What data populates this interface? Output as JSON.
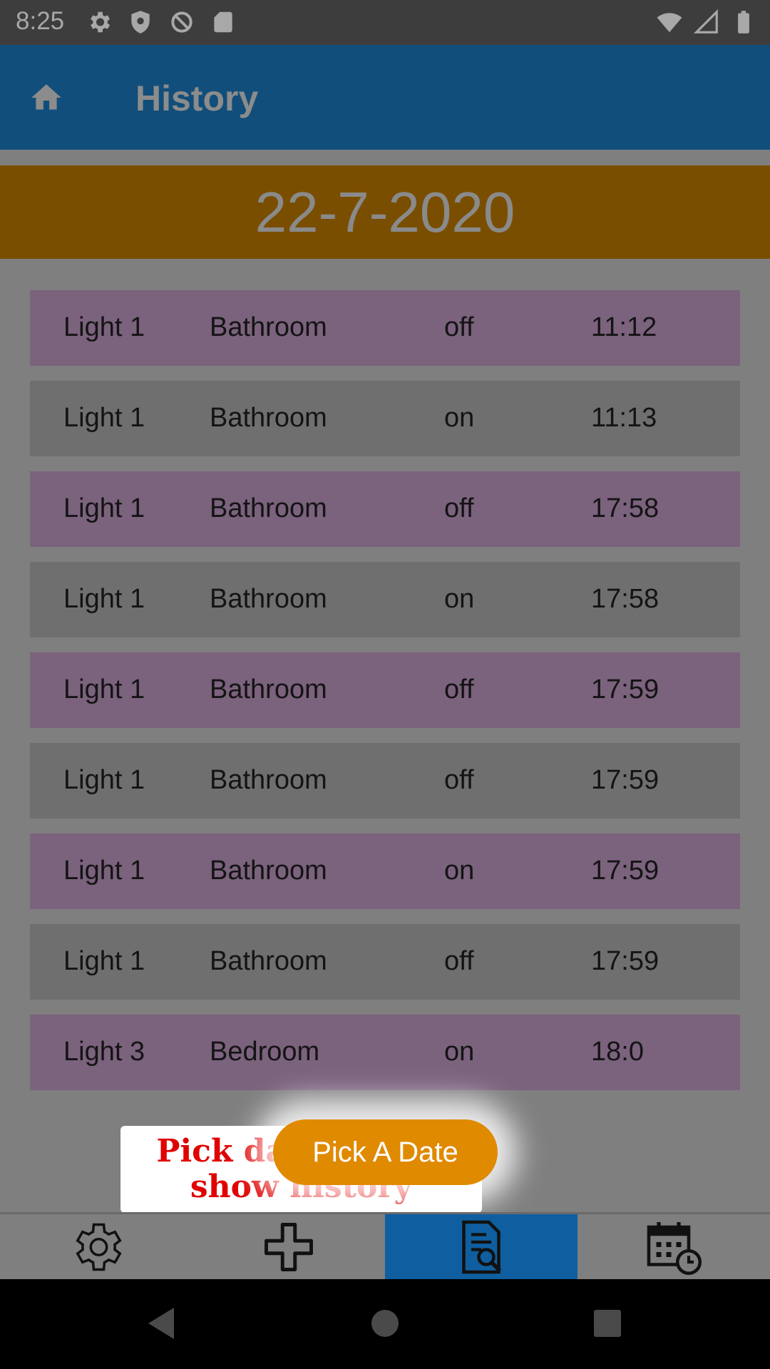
{
  "status_bar": {
    "time": "8:25",
    "left_icons": [
      "settings-gear-icon",
      "shield-icon",
      "no-sync-icon",
      "sd-card-icon"
    ],
    "right_icons": [
      "wifi-icon",
      "cell-signal-icon",
      "battery-icon"
    ]
  },
  "app_bar": {
    "title": "History",
    "home_icon": "home-icon",
    "background": "#114e7b"
  },
  "date_banner": {
    "date": "22-7-2020",
    "background": "#7a4e00"
  },
  "history": {
    "rows": [
      {
        "device": "Light 1",
        "room": "Bathroom",
        "state": "off",
        "time": "11:12"
      },
      {
        "device": "Light 1",
        "room": "Bathroom",
        "state": "on",
        "time": "11:13"
      },
      {
        "device": "Light 1",
        "room": "Bathroom",
        "state": "off",
        "time": "17:58"
      },
      {
        "device": "Light 1",
        "room": "Bathroom",
        "state": "on",
        "time": "17:58"
      },
      {
        "device": "Light 1",
        "room": "Bathroom",
        "state": "off",
        "time": "17:59"
      },
      {
        "device": "Light 1",
        "room": "Bathroom",
        "state": "off",
        "time": "17:59"
      },
      {
        "device": "Light 1",
        "room": "Bathroom",
        "state": "on",
        "time": "17:59"
      },
      {
        "device": "Light 1",
        "room": "Bathroom",
        "state": "off",
        "time": "17:59"
      },
      {
        "device": "Light 3",
        "room": "Bedroom",
        "state": "on",
        "time": "18:0"
      }
    ],
    "row_colors": [
      "#7b627d",
      "#6f6f6f"
    ]
  },
  "tooltip": {
    "line1": "Pick day want to",
    "line2": "show history"
  },
  "pick_date_button": {
    "label": "Pick A Date",
    "color": "#e08a00"
  },
  "bottom_nav": {
    "items": [
      {
        "icon": "settings-gear-icon",
        "active": false
      },
      {
        "icon": "plus-icon",
        "active": false
      },
      {
        "icon": "search-document-icon",
        "active": true
      },
      {
        "icon": "calendar-clock-icon",
        "active": false
      }
    ],
    "active_color": "#0f5fa0"
  },
  "system_nav": {
    "icons": [
      "back-triangle-icon",
      "home-circle-icon",
      "recents-square-icon"
    ]
  }
}
